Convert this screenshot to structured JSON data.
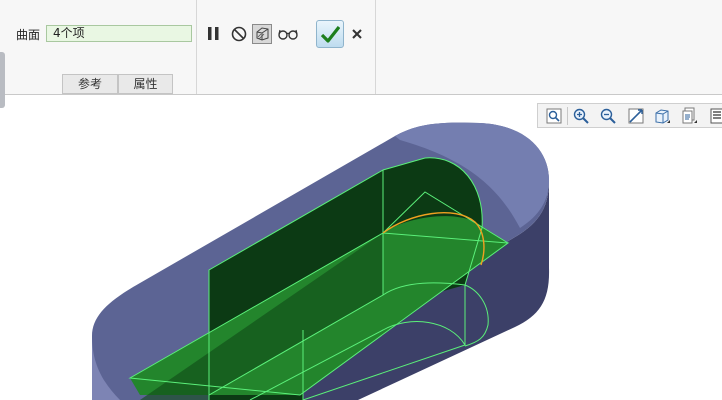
{
  "dashboard": {
    "surface_label": "曲面",
    "surface_value": "4个项",
    "tabs": [
      {
        "label": "参考"
      },
      {
        "label": "属性"
      }
    ],
    "icons": [
      "pause-icon",
      "no-entry-icon",
      "preview-icon",
      "glasses-icon",
      "checkmark-icon",
      "close-icon"
    ]
  },
  "view_toolbar": {
    "icons": [
      "zoom-window-icon",
      "zoom-in-icon",
      "zoom-out-icon",
      "refit-icon",
      "display-style-icon",
      "saved-views-icon",
      "layers-icon"
    ]
  },
  "model": {
    "body_color": "#4b5078",
    "top_color": "#6c76a8",
    "surface_color": "#23852c",
    "edge_color": "#5bf07a",
    "highlight_color": "#f0a020"
  }
}
